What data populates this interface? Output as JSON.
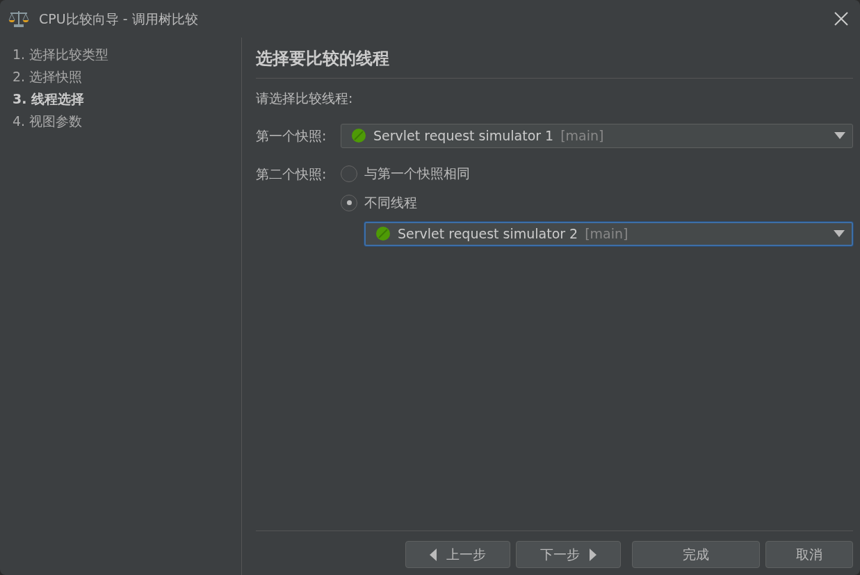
{
  "window": {
    "title": "CPU比较向导 - 调用树比较"
  },
  "steps": [
    {
      "label": "1. 选择比较类型",
      "selected": false
    },
    {
      "label": "2. 选择快照",
      "selected": false
    },
    {
      "label": "3. 线程选择",
      "selected": true
    },
    {
      "label": "4. 视图参数",
      "selected": false
    }
  ],
  "heading": "选择要比较的线程",
  "instruction": "请选择比较线程:",
  "first_snapshot": {
    "label": "第一个快照:",
    "dropdown": {
      "value": "Servlet request simulator 1",
      "suffix": "[main]",
      "focused": false
    }
  },
  "second_snapshot": {
    "label": "第二个快照:",
    "options": [
      {
        "label": "与第一个快照相同",
        "selected": false
      },
      {
        "label": "不同线程",
        "selected": true
      }
    ],
    "dropdown": {
      "value": "Servlet request simulator 2",
      "suffix": "[main]",
      "focused": true
    }
  },
  "buttons": [
    {
      "label": "上一步",
      "kind": "back"
    },
    {
      "label": "下一步",
      "kind": "next"
    },
    {
      "label": "完成",
      "kind": "plain"
    },
    {
      "label": "取消",
      "kind": "plain"
    }
  ]
}
